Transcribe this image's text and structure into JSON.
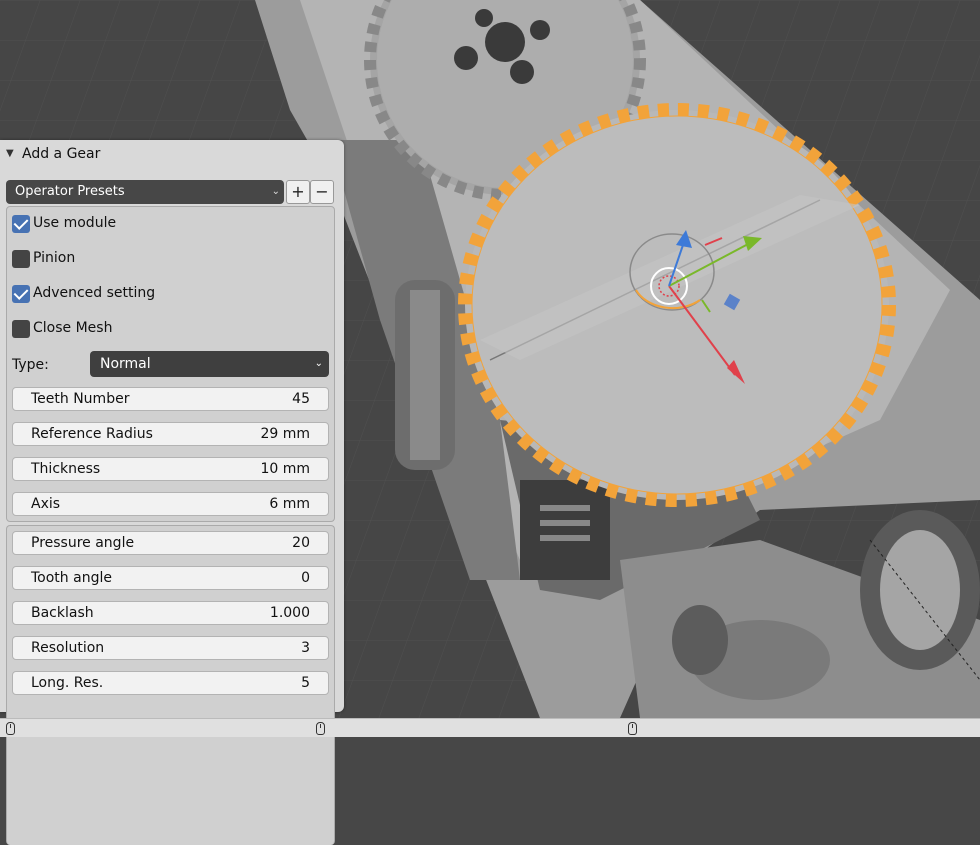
{
  "panel": {
    "title": "Add a Gear",
    "presets": {
      "label": "Operator Presets",
      "add_label": "+",
      "remove_label": "−"
    },
    "checkboxes": [
      {
        "label": "Use module",
        "checked": true
      },
      {
        "label": "Pinion",
        "checked": false
      },
      {
        "label": "Advenced setting",
        "checked": true
      },
      {
        "label": "Close Mesh",
        "checked": false
      }
    ],
    "type": {
      "label": "Type:",
      "value": "Normal"
    },
    "fields": [
      {
        "label": "Teeth Number",
        "value": "45"
      },
      {
        "label": "Reference Radius",
        "value": "29 mm"
      },
      {
        "label": "Thickness",
        "value": "10 mm"
      },
      {
        "label": "Axis",
        "value": "6 mm"
      }
    ],
    "advanced_fields": [
      {
        "label": "Pressure angle",
        "value": "20"
      },
      {
        "label": "Tooth angle",
        "value": "0"
      },
      {
        "label": "Backlash",
        "value": "1.000"
      },
      {
        "label": "Resolution",
        "value": "3"
      },
      {
        "label": "Long. Res.",
        "value": "5"
      }
    ]
  },
  "colors": {
    "selection_outline": "#f2a33a",
    "checkbox_on": "#4772b3",
    "gizmo_x": "#e0414b",
    "gizmo_y": "#7ab82a",
    "gizmo_z": "#3d7ad8"
  },
  "icons": [
    "mouse-left-icon",
    "mouse-middle-icon",
    "mouse-right-icon",
    "chevron-down-icon",
    "disclosure-triangle-icon"
  ]
}
